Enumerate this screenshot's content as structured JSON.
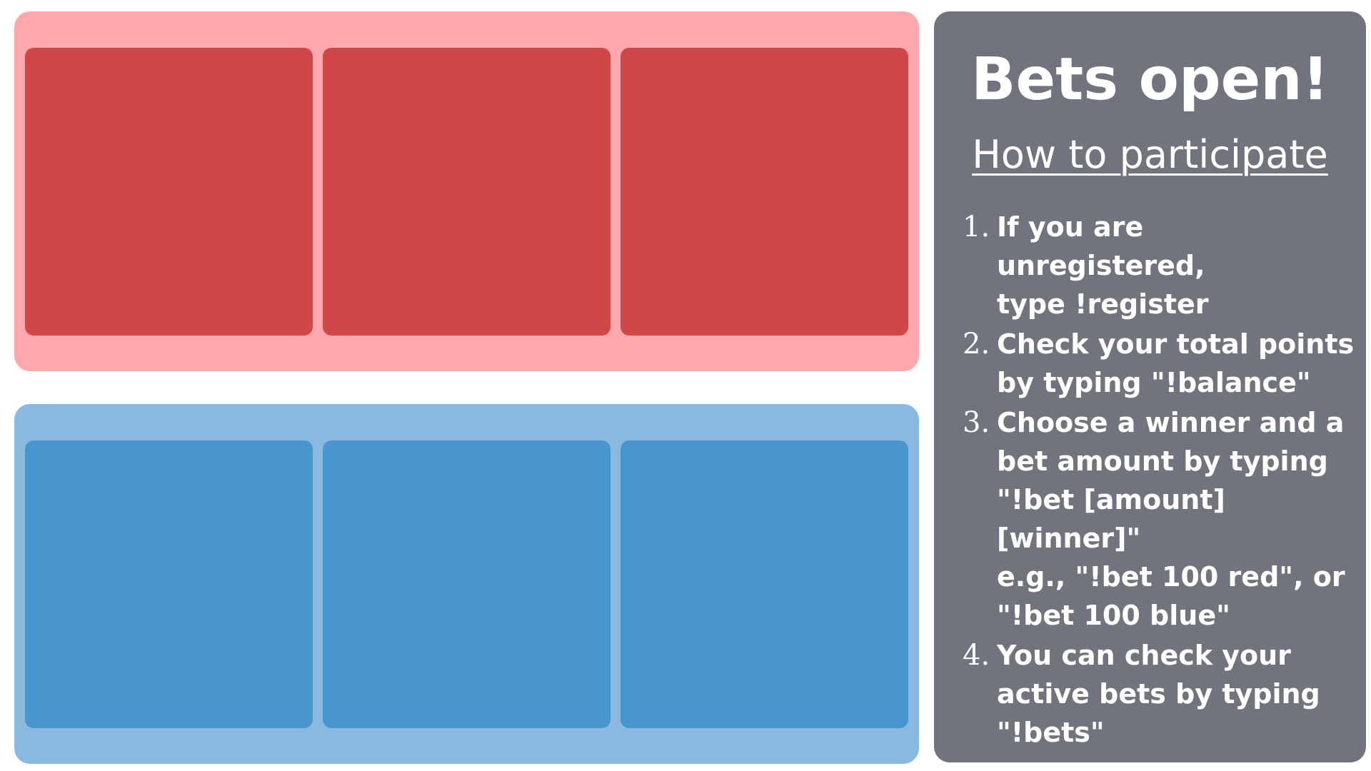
{
  "colors": {
    "background": "#ffffff",
    "red_panel": "#fea7ac",
    "red_slot": "#cf4749",
    "blue_panel": "#89b9e0",
    "blue_slot": "#4996ce",
    "info_panel": "#72747d",
    "info_text": "#ffffff"
  },
  "teams": {
    "red": {
      "slots": [
        "",
        "",
        ""
      ]
    },
    "blue": {
      "slots": [
        "",
        "",
        ""
      ]
    }
  },
  "info": {
    "title": "Bets open!",
    "subtitle": "How to participate",
    "steps": [
      {
        "number": "1.",
        "text": "If you are unregistered,\ntype !register"
      },
      {
        "number": "2.",
        "text": "Check your total points\nby typing \"!balance\""
      },
      {
        "number": "3.",
        "text": "Choose a winner and a\nbet amount by typing\n\"!bet [amount] [winner]\"\ne.g., \"!bet 100 red\", or\n\"!bet 100 blue\""
      },
      {
        "number": "4.",
        "text": "You can check your\nactive bets by typing\n\"!bets\""
      }
    ]
  }
}
